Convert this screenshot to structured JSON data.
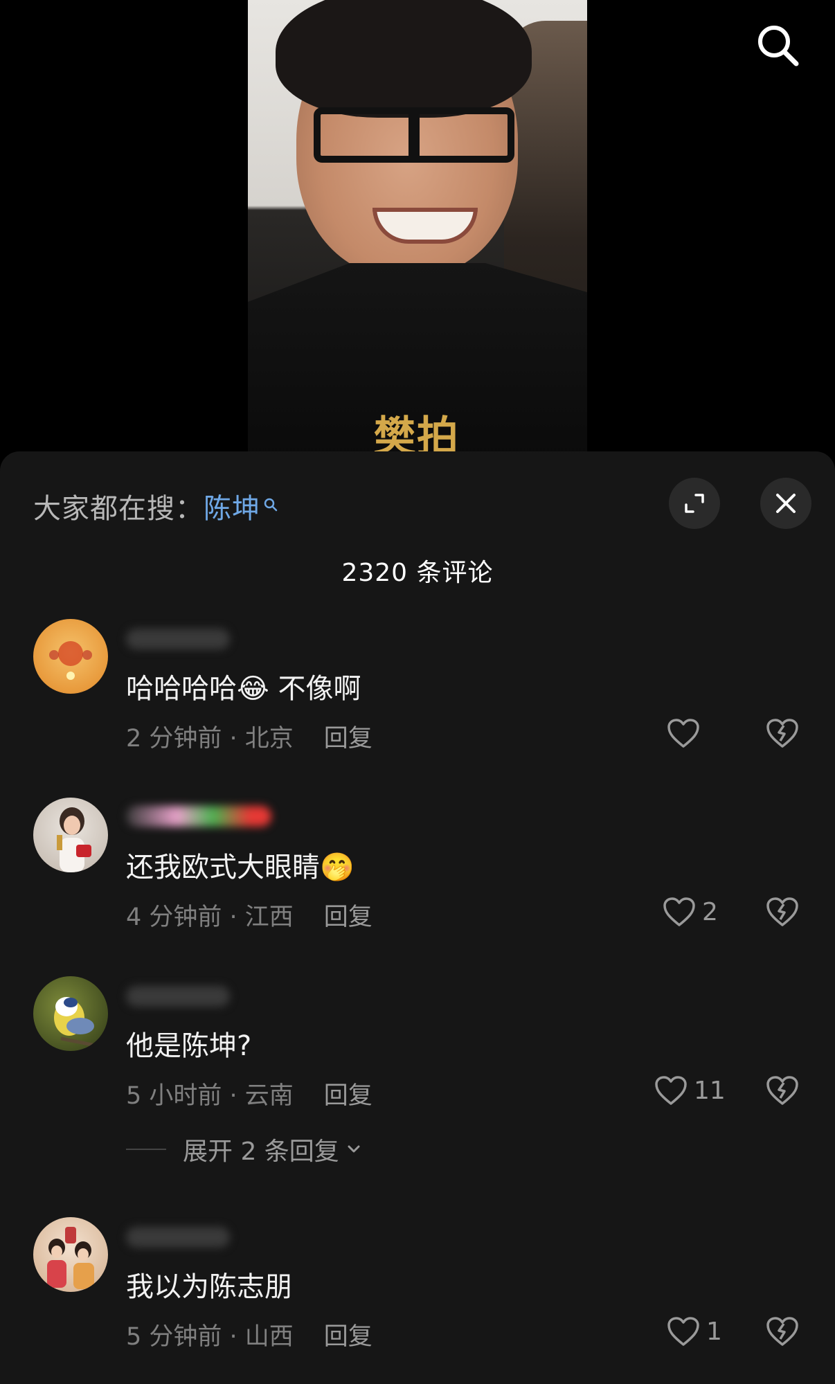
{
  "video": {
    "watermark": "樊拍"
  },
  "sheet": {
    "trending_prefix": "大家都在搜：",
    "trending_keyword": "陈坤",
    "comment_count": "2320 条评论"
  },
  "comments": [
    {
      "text": "哈哈哈哈😂 不像啊",
      "meta": "2 分钟前 · 北京",
      "reply": "回复",
      "likes": ""
    },
    {
      "text": "还我欧式大眼睛🤭",
      "meta": "4 分钟前 · 江西",
      "reply": "回复",
      "likes": "2"
    },
    {
      "text": "他是陈坤?",
      "meta": "5 小时前 · 云南",
      "reply": "回复",
      "likes": "11",
      "expand": "展开 2 条回复"
    },
    {
      "text": "我以为陈志朋",
      "meta": "5 分钟前 · 山西",
      "reply": "回复",
      "likes": "1"
    }
  ],
  "colors": {
    "accent": "#6fa8e6",
    "sheet_bg": "#161616"
  }
}
